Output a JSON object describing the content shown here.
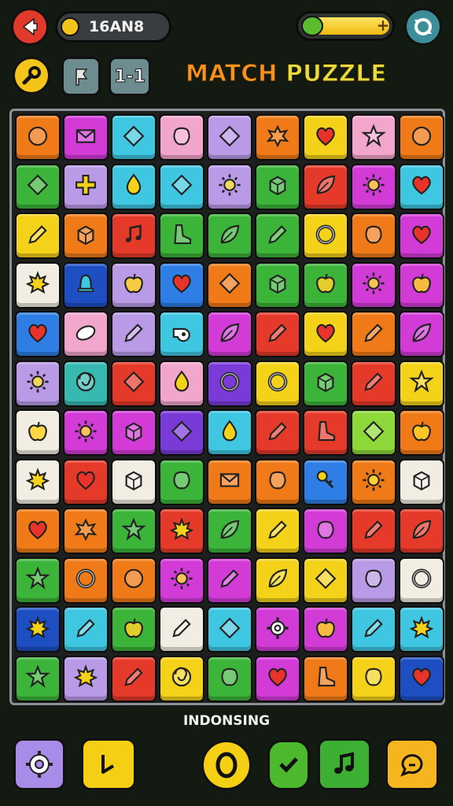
{
  "header": {
    "score_text": "16AN8",
    "title_part1": "MATCH",
    "title_part2": "PUZZLE",
    "level_label": "1-1"
  },
  "footer": {
    "label": "INDONSING"
  },
  "colors": {
    "orange": "#f07a18",
    "magenta": "#d23bd6",
    "cyan": "#3fc6e0",
    "pink": "#f3a6cc",
    "lavender": "#b89ae6",
    "yellow": "#f4d21a",
    "green": "#3cb43a",
    "blue": "#2e7ee6",
    "red": "#e53a2a",
    "white": "#f2ede3",
    "purple": "#7a3ad8",
    "lime": "#8ed93a",
    "teal": "#38b9b0",
    "darkblue": "#1d4fc2"
  },
  "board": [
    [
      [
        "orange",
        "circle"
      ],
      [
        "magenta",
        "envelope"
      ],
      [
        "cyan",
        "diamond"
      ],
      [
        "pink",
        "blob"
      ],
      [
        "lavender",
        "diamond"
      ],
      [
        "orange",
        "splat"
      ],
      [
        "yellow",
        "heart"
      ],
      [
        "pink",
        "star"
      ],
      [
        "orange",
        "circle"
      ]
    ],
    [
      [
        "green",
        "diamond"
      ],
      [
        "lavender",
        "cross"
      ],
      [
        "cyan",
        "drop"
      ],
      [
        "cyan",
        "diamond"
      ],
      [
        "lavender",
        "sun"
      ],
      [
        "green",
        "box"
      ],
      [
        "red",
        "leaf"
      ],
      [
        "magenta",
        "sun"
      ],
      [
        "cyan",
        "heart"
      ]
    ],
    [
      [
        "yellow",
        "pencil"
      ],
      [
        "orange",
        "box"
      ],
      [
        "red",
        "note"
      ],
      [
        "green",
        "boot"
      ],
      [
        "green",
        "leaf"
      ],
      [
        "green",
        "pencil"
      ],
      [
        "yellow",
        "ring"
      ],
      [
        "orange",
        "blob"
      ],
      [
        "magenta",
        "heart"
      ]
    ],
    [
      [
        "white",
        "maple"
      ],
      [
        "darkblue",
        "bell"
      ],
      [
        "lavender",
        "apple"
      ],
      [
        "blue",
        "heart"
      ],
      [
        "orange",
        "diamond"
      ],
      [
        "green",
        "box"
      ],
      [
        "green",
        "apple"
      ],
      [
        "magenta",
        "sun"
      ],
      [
        "magenta",
        "apple"
      ]
    ],
    [
      [
        "blue",
        "heart"
      ],
      [
        "pink",
        "oval"
      ],
      [
        "lavender",
        "pencil"
      ],
      [
        "cyan",
        "whistle"
      ],
      [
        "magenta",
        "leaf"
      ],
      [
        "red",
        "pencil"
      ],
      [
        "yellow",
        "heart"
      ],
      [
        "orange",
        "pencil"
      ],
      [
        "magenta",
        "leaf"
      ]
    ],
    [
      [
        "lavender",
        "sun"
      ],
      [
        "teal",
        "swirl"
      ],
      [
        "red",
        "diamond"
      ],
      [
        "pink",
        "drop"
      ],
      [
        "purple",
        "ring"
      ],
      [
        "yellow",
        "ring"
      ],
      [
        "green",
        "box"
      ],
      [
        "red",
        "pencil"
      ],
      [
        "yellow",
        "star"
      ]
    ],
    [
      [
        "white",
        "apple"
      ],
      [
        "magenta",
        "sun"
      ],
      [
        "magenta",
        "box"
      ],
      [
        "purple",
        "diamond"
      ],
      [
        "cyan",
        "drop"
      ],
      [
        "red",
        "pencil"
      ],
      [
        "red",
        "boot"
      ],
      [
        "lime",
        "diamond"
      ],
      [
        "orange",
        "apple"
      ]
    ],
    [
      [
        "white",
        "maple"
      ],
      [
        "red",
        "heart"
      ],
      [
        "white",
        "box"
      ],
      [
        "green",
        "blob"
      ],
      [
        "orange",
        "envelope"
      ],
      [
        "orange",
        "blob"
      ],
      [
        "blue",
        "key"
      ],
      [
        "orange",
        "sun"
      ],
      [
        "white",
        "box"
      ]
    ],
    [
      [
        "orange",
        "heart"
      ],
      [
        "orange",
        "splat"
      ],
      [
        "green",
        "star"
      ],
      [
        "red",
        "maple"
      ],
      [
        "green",
        "leaf"
      ],
      [
        "yellow",
        "pencil"
      ],
      [
        "magenta",
        "blob"
      ],
      [
        "red",
        "pencil"
      ],
      [
        "red",
        "leaf"
      ]
    ],
    [
      [
        "green",
        "star"
      ],
      [
        "orange",
        "ring"
      ],
      [
        "orange",
        "circle"
      ],
      [
        "magenta",
        "sun"
      ],
      [
        "magenta",
        "pencil"
      ],
      [
        "yellow",
        "leaf"
      ],
      [
        "yellow",
        "diamond"
      ],
      [
        "lavender",
        "blob"
      ],
      [
        "white",
        "ring"
      ]
    ],
    [
      [
        "darkblue",
        "maple"
      ],
      [
        "cyan",
        "pencil"
      ],
      [
        "green",
        "apple"
      ],
      [
        "white",
        "pencil"
      ],
      [
        "cyan",
        "diamond"
      ],
      [
        "magenta",
        "gear"
      ],
      [
        "magenta",
        "apple"
      ],
      [
        "cyan",
        "pencil"
      ],
      [
        "cyan",
        "maple"
      ]
    ],
    [
      [
        "green",
        "star"
      ],
      [
        "lavender",
        "maple"
      ],
      [
        "red",
        "pencil"
      ],
      [
        "yellow",
        "swirl"
      ],
      [
        "green",
        "blob"
      ],
      [
        "magenta",
        "heart"
      ],
      [
        "orange",
        "boot"
      ],
      [
        "yellow",
        "blob"
      ],
      [
        "darkblue",
        "heart"
      ]
    ]
  ],
  "buttons": {
    "back": "back-icon",
    "key": "key-icon",
    "hint": "flag-icon",
    "settings": "settings-icon",
    "gear": "gear-icon",
    "note": "music-note-icon",
    "ring": "ring-icon",
    "check": "check-icon",
    "music": "music-icon",
    "chat": "chat-icon"
  }
}
